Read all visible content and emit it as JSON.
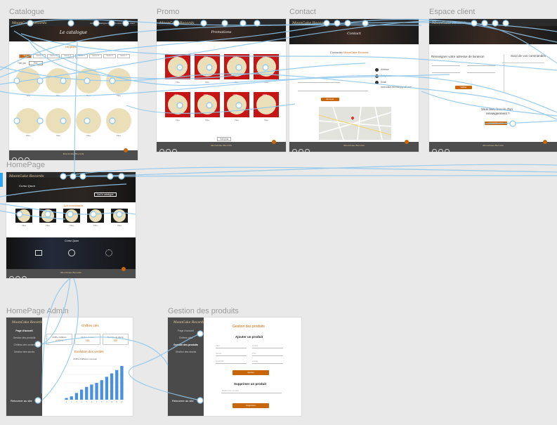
{
  "artboards": {
    "catalogue": {
      "label": "Catalogue",
      "logo": "MoonCake Records",
      "nav": "Accueil  Catalogue  Promo  Contact  Espace client",
      "banner_title": "Le catalogue",
      "subtitle": "Les genres",
      "filters": [
        "Tous",
        "Genre 1",
        "Genre 2",
        "Genre 3",
        "Genre 4",
        "Genre 5",
        "Genre 6",
        "Genre 7"
      ],
      "select_label": "Trier par",
      "select_value": "Prix",
      "item_caption": "Titre",
      "footer_title": "MoonCake Records"
    },
    "promo": {
      "label": "Promo",
      "logo": "MoonCake Records",
      "banner_title": "Promotions",
      "badge": "-20%",
      "item_caption": "Titre",
      "more": "Voir plus",
      "footer_title": "MoonCake Records"
    },
    "contact": {
      "label": "Contact",
      "logo": "MoonCake Records",
      "banner_title": "Contact",
      "intro_prefix": "Contactez ",
      "intro_brand": "MoonCake Records",
      "info": [
        "Adresse",
        "Téléphone",
        "Email"
      ],
      "email": "mooncake.records@gmail.com",
      "send": "Envoyer",
      "footer_title": "MoonCake Records"
    },
    "espace_client": {
      "label": "Espace client",
      "logo": "MoonCake Records",
      "address_title": "Renseigner votre adresse de livraison",
      "orders_title": "Suivi de vos commandes",
      "validate": "Valider",
      "help_line1": "Vous avez besoin d'un",
      "help_line2": "renseignement ?",
      "help_button": "Contactez-nous",
      "footer_title": "MoonCake Records"
    },
    "homepage": {
      "label": "HomePage",
      "logo": "MoonCake Records",
      "banner_title": "Come Ijaon",
      "banner_button": "Voir le catalogue",
      "news_title": "Les nouveautés",
      "item_caption": "Titre",
      "about_title": "Come Ijaon",
      "footer_title": "MoonCake Records"
    },
    "homepage_admin": {
      "label": "HomePage Admin",
      "logo": "MoonCake Records",
      "menu": [
        "Page d'accueil",
        "Gestion des produits",
        "Chiffres des ventes",
        "Gestion des stocks"
      ],
      "return": "Retourner au site",
      "key_title": "Chiffres clés",
      "kpis": [
        {
          "label": "Chiffre d'affaires",
          "value": "4 000 €"
        },
        {
          "label": "Vinyles vendus",
          "value": "150"
        },
        {
          "label": "Nombre de clients",
          "value": "130"
        }
      ],
      "chart_title": "Evolution des ventes",
      "chart_subtitle": "Chiffre d'affaires mensuel"
    },
    "gestion_produits": {
      "label": "Gestion des produits",
      "logo": "MoonCake Records",
      "menu": [
        "Page d'accueil",
        "Chiffres clés",
        "Gestion des produits",
        "Gestion des stocks"
      ],
      "return": "Retourner au site",
      "title": "Gestion des produits",
      "add_title": "Ajouter un produit",
      "fields": [
        "Titre",
        "Artiste",
        "Genre",
        "Prix",
        "Quantité",
        "Image"
      ],
      "add_button": "Ajouter",
      "delete_title": "Supprimer un produit",
      "delete_field": "Référence produit",
      "delete_button": "Supprimer"
    }
  },
  "chart_data": {
    "type": "bar",
    "title": "Chiffre d'affaires mensuel",
    "categories": [
      "1",
      "2",
      "3",
      "4",
      "5",
      "6",
      "7",
      "8",
      "9",
      "10",
      "11",
      "12"
    ],
    "values": [
      0.5,
      1,
      2,
      3,
      3.8,
      4.5,
      5,
      5.8,
      6.8,
      7.8,
      8.8,
      10
    ],
    "color": "#4a90e2"
  },
  "colors": {
    "accent": "#c8660b",
    "arrow": "#8fc7ee",
    "dark": "#2b2b2b"
  }
}
